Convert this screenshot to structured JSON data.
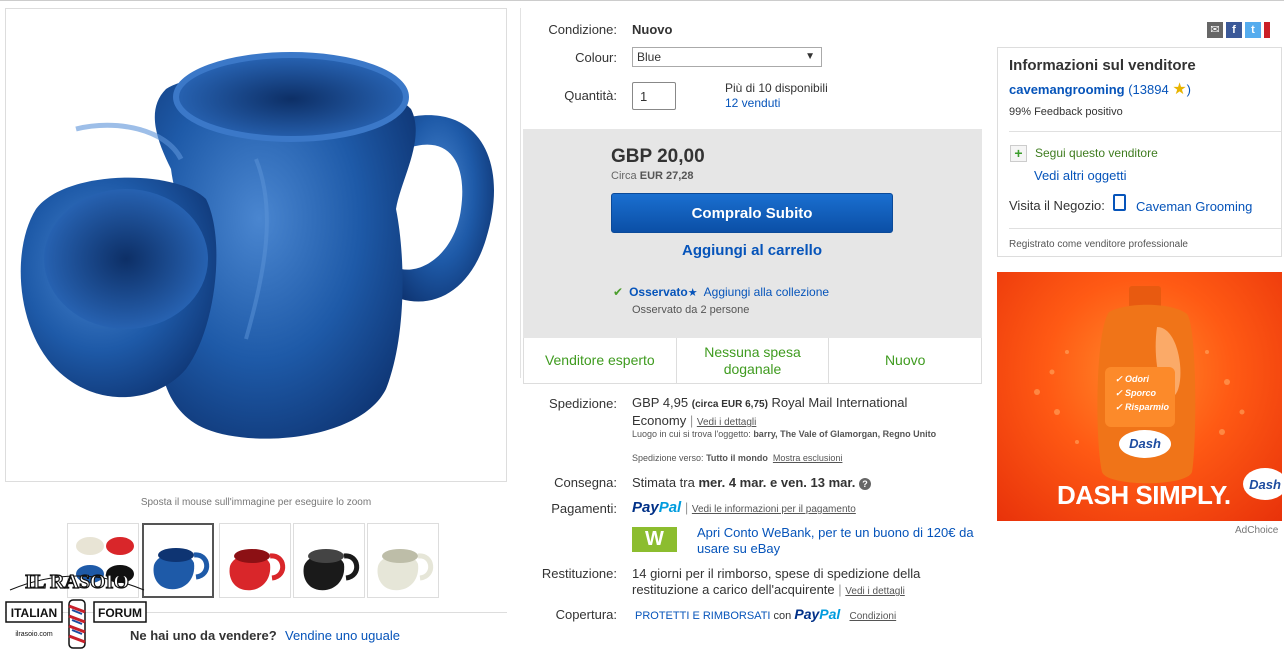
{
  "gallery": {
    "zoom_hint": "Sposta il mouse sull'immagine per eseguire lo zoom",
    "sell_question": "Ne hai uno da vendere?",
    "sell_link": "Vendine uno uguale"
  },
  "watermark": {
    "title": "IL RASOIO",
    "left": "ITALIAN",
    "right": "FORUM",
    "url": "ilrasoio.com"
  },
  "item": {
    "condition_label": "Condizione:",
    "condition_value": "Nuovo",
    "colour_label": "Colour:",
    "colour_value": "Blue",
    "quantity_label": "Quantità:",
    "quantity_value": "1",
    "available": "Più di 10 disponibili",
    "sold": "12 venduti"
  },
  "buy": {
    "price": "GBP 20,00",
    "circa_label": "Circa",
    "circa_value": "EUR 27,28",
    "buy_now": "Compralo Subito",
    "add_cart": "Aggiungi al carrello",
    "watched": "Osservato",
    "add_collection": "Aggiungi alla collezione",
    "watch_count": "Osservato da 2 persone"
  },
  "badges": [
    "Venditore esperto",
    "Nessuna spesa doganale",
    "Nuovo"
  ],
  "details": {
    "shipping_label": "Spedizione:",
    "shipping_price": "GBP 4,95",
    "shipping_circa": "(circa EUR 6,75)",
    "shipping_service": "Royal Mail International Economy",
    "see_details": "Vedi i dettagli",
    "location_label": "Luogo in cui si trova l'oggetto:",
    "location_value": "barry, The Vale of Glamorgan, Regno Unito",
    "ship_to_label": "Spedizione verso:",
    "ship_to_value": "Tutto il mondo",
    "exclusions": "Mostra esclusioni",
    "delivery_label": "Consegna:",
    "delivery_prefix": "Stimata tra",
    "delivery_value": "mer. 4 mar. e ven. 13 mar.",
    "payments_label": "Pagamenti:",
    "paypal_a": "Pay",
    "paypal_b": "Pal",
    "payment_info": "Vedi le informazioni per il pagamento",
    "webank_logo": "W",
    "webank_text": "Apri Conto WeBank, per te un buono di 120€ da usare su eBay",
    "returns_label": "Restituzione:",
    "returns_text": "14 giorni per il rimborso, spese di spedizione della restituzione a carico dell'acquirente",
    "coverage_label": "Copertura:",
    "coverage_text": "PROTETTI E RIMBORSATI",
    "coverage_with": "con",
    "conditions": "Condizioni"
  },
  "seller": {
    "title": "Informazioni sul venditore",
    "name": "cavemangrooming",
    "score_open": "(13894",
    "score_close": ")",
    "feedback": "99% Feedback positivo",
    "follow": "Segui questo venditore",
    "other_items": "Vedi altri oggetti",
    "store_label": "Visita il Negozio:",
    "store_name": "Caveman Grooming",
    "registered": "Registrato come venditore professionale"
  },
  "share_icons": [
    "mail-icon",
    "facebook-icon",
    "twitter-icon",
    "pinterest-icon"
  ],
  "ad": {
    "slogan": "DASH SIMPLY.",
    "brand": "Dash",
    "brand_sub": "Simply",
    "claims": [
      "Odori",
      "Sporco",
      "Risparmio"
    ],
    "choices": "AdChoice"
  },
  "colors": {
    "link": "#0654ba",
    "green": "#3f9b1f",
    "buy_button": "#0b5cba",
    "mug_blue": "#1e5aa8"
  }
}
